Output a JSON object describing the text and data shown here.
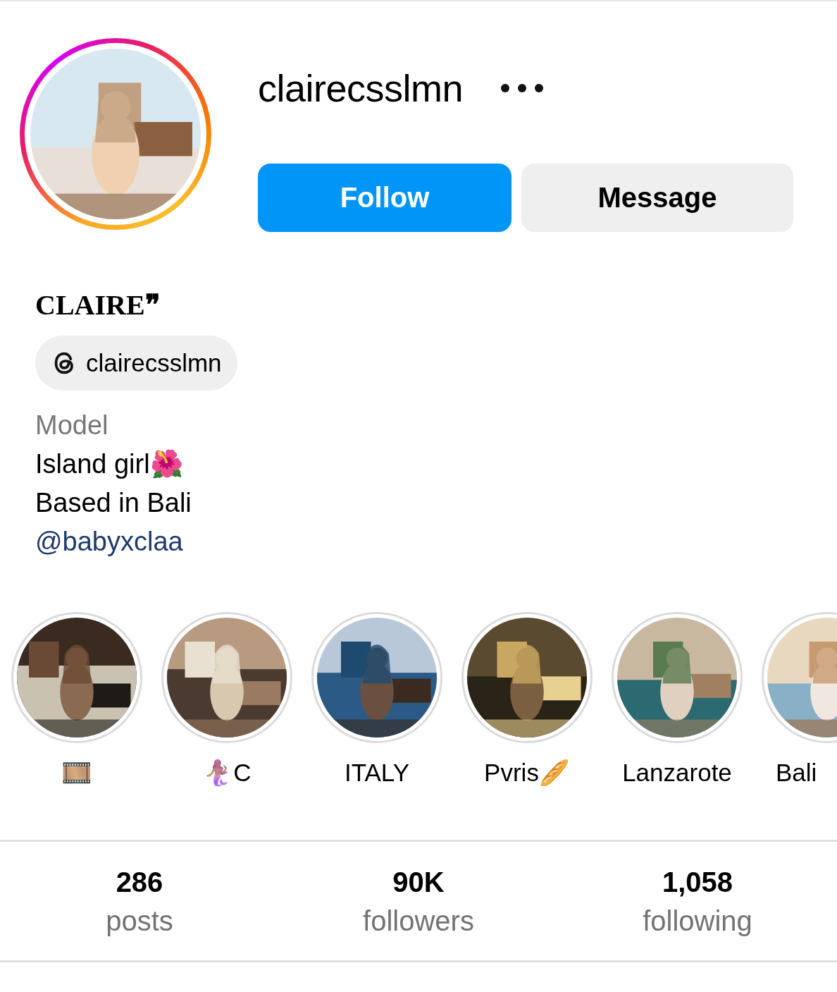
{
  "profile": {
    "username": "clairecsslmn",
    "has_story": true,
    "buttons": [
      {
        "label": "Follow",
        "kind": "primary"
      },
      {
        "label": "Message",
        "kind": "secondary"
      }
    ],
    "display_name": "CLAIRE❞",
    "threads_badge": "clairecsslmn",
    "category": "Model",
    "bio": [
      "Island girl🌺",
      "Based in Bali"
    ],
    "bio_link": "@babyxclaa"
  },
  "highlights": [
    {
      "label": "🎞️"
    },
    {
      "label": "🧜🏽‍♀️C"
    },
    {
      "label": "ITALY"
    },
    {
      "label": "Pvris🥖"
    },
    {
      "label": "Lanzarote"
    },
    {
      "label": "Bali"
    }
  ],
  "stats": [
    {
      "value": "286",
      "label": "posts"
    },
    {
      "value": "90K",
      "label": "followers"
    },
    {
      "value": "1,058",
      "label": "following"
    }
  ]
}
